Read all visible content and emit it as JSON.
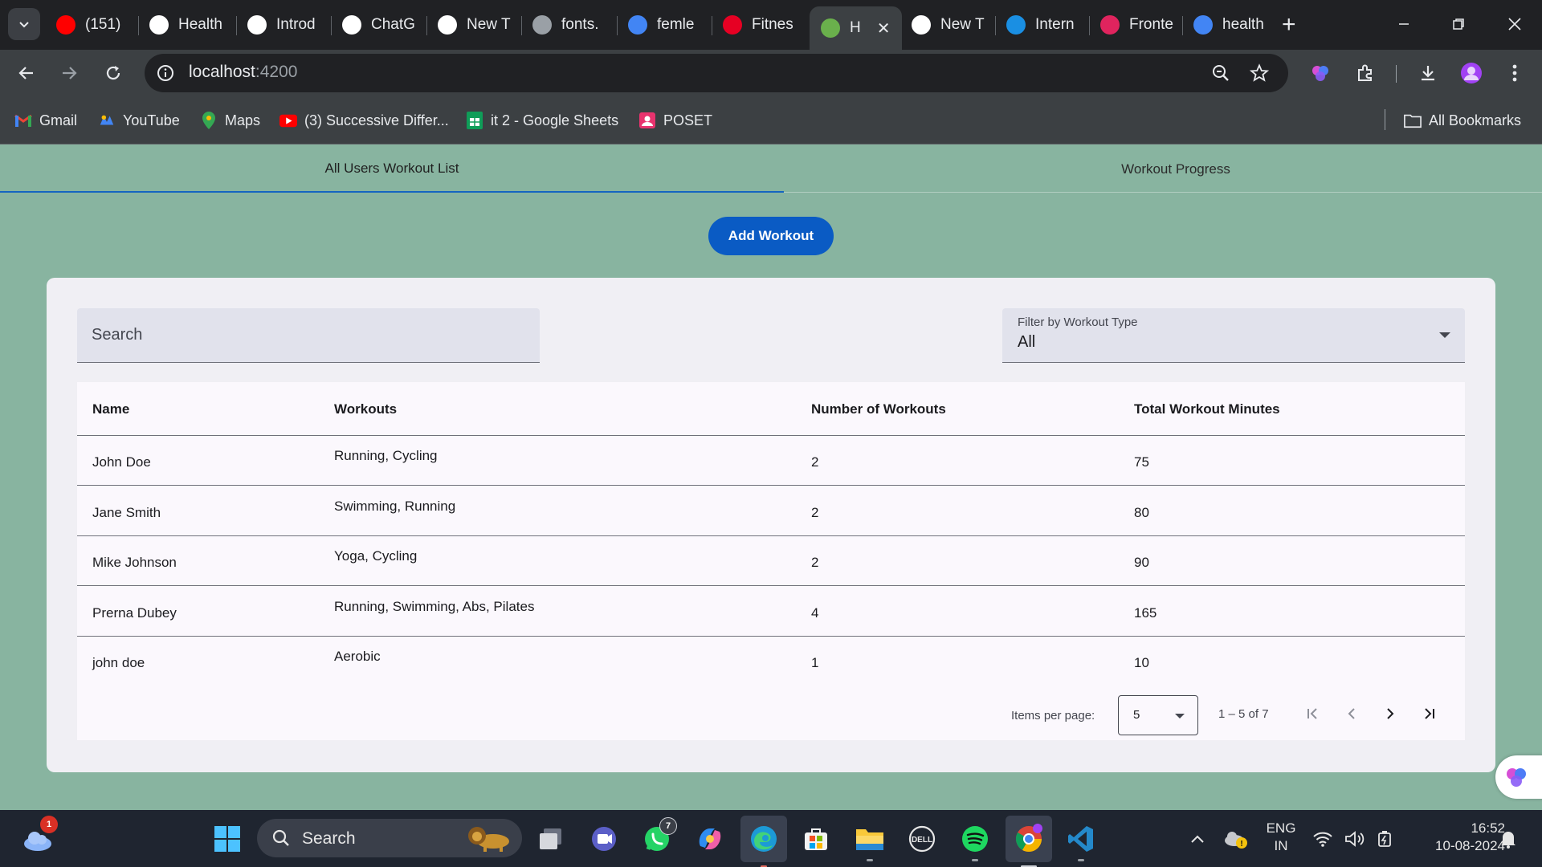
{
  "browser": {
    "tabs": [
      {
        "title": "(151)",
        "favicon": "youtube-icon",
        "color": "#ff0000"
      },
      {
        "title": "Health",
        "favicon": "github-icon",
        "color": "#ffffff"
      },
      {
        "title": "Introd",
        "favicon": "openai-icon",
        "color": "#ffffff"
      },
      {
        "title": "ChatG",
        "favicon": "openai-icon",
        "color": "#ffffff"
      },
      {
        "title": "New T",
        "favicon": "chrome-icon",
        "color": "#ffffff"
      },
      {
        "title": "fonts.",
        "favicon": "globe-icon",
        "color": "#9aa0a6"
      },
      {
        "title": "femle",
        "favicon": "google-icon",
        "color": "#4285f4"
      },
      {
        "title": "Fitnes",
        "favicon": "pinterest-icon",
        "color": "#e60023"
      },
      {
        "title": "H",
        "favicon": "health-app-icon",
        "color": "#6ab04c",
        "active": true
      },
      {
        "title": "New T",
        "favicon": "chrome-icon",
        "color": "#ffffff"
      },
      {
        "title": "Intern",
        "favicon": "internshala-icon",
        "color": "#1a8fe3"
      },
      {
        "title": "Fronte",
        "favicon": "frontend-icon",
        "color": "#e0245e"
      },
      {
        "title": "health",
        "favicon": "google-icon",
        "color": "#4285f4"
      }
    ],
    "url_host": "localhost",
    "url_port": ":4200",
    "bookmarks": [
      {
        "label": "Gmail",
        "icon": "gmail-icon"
      },
      {
        "label": "YouTube",
        "icon": "youtube-icon"
      },
      {
        "label": "Maps",
        "icon": "maps-icon"
      },
      {
        "label": "(3) Successive Differ...",
        "icon": "youtube-icon"
      },
      {
        "label": "it 2 - Google Sheets",
        "icon": "sheets-icon"
      },
      {
        "label": "POSET",
        "icon": "classroom-icon"
      }
    ],
    "all_bookmarks": "All Bookmarks"
  },
  "app": {
    "tabs": [
      "All Users Workout List",
      "Workout Progress"
    ],
    "add_button": "Add Workout",
    "search_placeholder": "Search",
    "filter": {
      "label": "Filter by Workout Type",
      "value": "All"
    },
    "table": {
      "headers": [
        "Name",
        "Workouts",
        "Number of Workouts",
        "Total Workout Minutes"
      ],
      "rows": [
        {
          "name": "John Doe",
          "workouts": "Running, Cycling",
          "count": "2",
          "minutes": "75"
        },
        {
          "name": "Jane Smith",
          "workouts": "Swimming, Running",
          "count": "2",
          "minutes": "80"
        },
        {
          "name": "Mike Johnson",
          "workouts": "Yoga, Cycling",
          "count": "2",
          "minutes": "90"
        },
        {
          "name": "Prerna Dubey",
          "workouts": "Running, Swimming, Abs, Pilates",
          "count": "4",
          "minutes": "165"
        },
        {
          "name": "john doe",
          "workouts": "Aerobic",
          "count": "1",
          "minutes": "10"
        }
      ]
    },
    "paginator": {
      "label": "Items per page:",
      "page_size": "5",
      "range": "1 – 5 of 7"
    }
  },
  "taskbar": {
    "search": "Search",
    "weather_badge": "1",
    "whatsapp_badge": "7",
    "lang_line1": "ENG",
    "lang_line2": "IN",
    "time": "16:52",
    "date": "10-08-2024"
  }
}
